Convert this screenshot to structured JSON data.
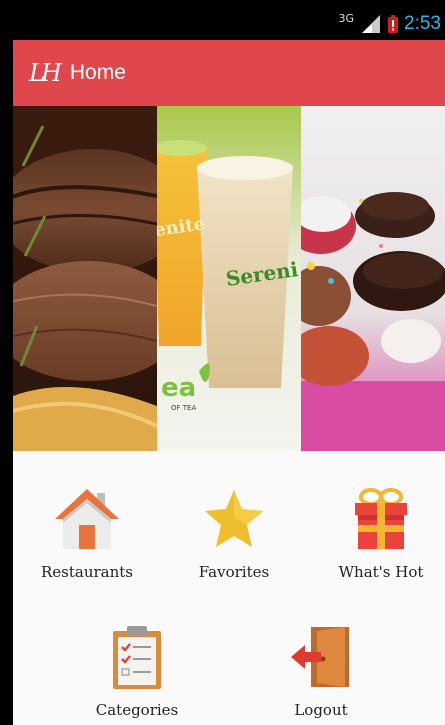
{
  "status_bar": {
    "network": "3G",
    "time": "2:53"
  },
  "action_bar": {
    "logo": "LH",
    "title": "Home"
  },
  "banner": {
    "panels": [
      "steak",
      "tea",
      "cupcakes"
    ],
    "tea_brand": "Sereni",
    "tea_side_text": "enite",
    "tea_logo": "ea",
    "tea_logo_sub": "OF TEA"
  },
  "menu": {
    "restaurants": "Restaurants",
    "favorites": "Favorites",
    "whats_hot": "What's Hot",
    "categories": "Categories",
    "logout": "Logout"
  },
  "colors": {
    "accent": "#e0474c",
    "clock": "#33b5e5"
  }
}
